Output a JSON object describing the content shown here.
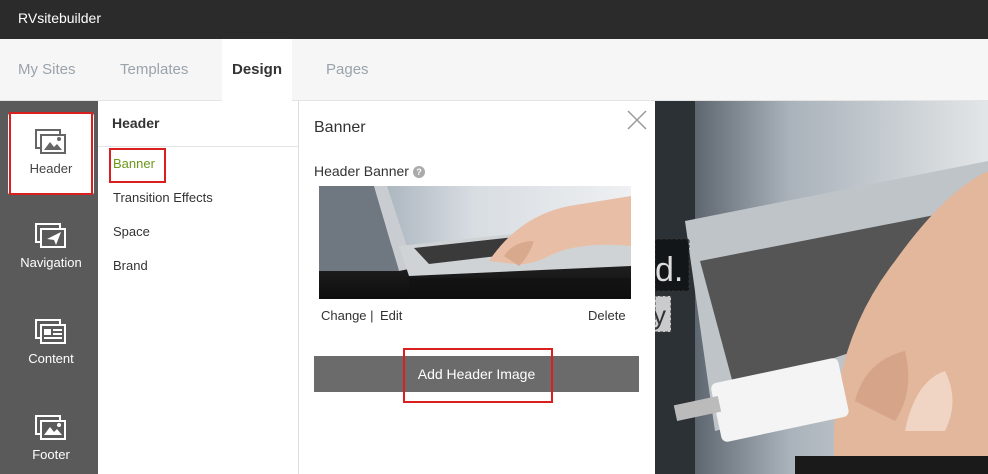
{
  "app": {
    "title": "RVsitebuilder"
  },
  "nav": {
    "tabs": [
      {
        "label": "My Sites"
      },
      {
        "label": "Templates"
      },
      {
        "label": "Design"
      },
      {
        "label": "Pages"
      }
    ]
  },
  "sidebar": {
    "items": [
      {
        "label": "Header",
        "icon": "header-icon"
      },
      {
        "label": "Navigation",
        "icon": "navigation-icon"
      },
      {
        "label": "Content",
        "icon": "content-icon"
      },
      {
        "label": "Footer",
        "icon": "footer-icon"
      }
    ]
  },
  "submenu": {
    "title": "Header",
    "items": [
      {
        "label": "Banner"
      },
      {
        "label": "Transition Effects"
      },
      {
        "label": "Space"
      },
      {
        "label": "Brand"
      }
    ]
  },
  "panel": {
    "title": "Banner",
    "banner_label": "Header Banner",
    "help_glyph": "?",
    "change_label": "Change |",
    "edit_label": "Edit",
    "delete_label": "Delete",
    "add_button_label": "Add Header Image"
  },
  "preview": {
    "fragment_1": "d.",
    "fragment_2": "y"
  },
  "colors": {
    "topbar": "#2b2b2b",
    "sidebar": "#5a5a5a",
    "active_link": "#6a9a1a",
    "highlight": "#d9201e",
    "button": "#6b6b6b"
  }
}
